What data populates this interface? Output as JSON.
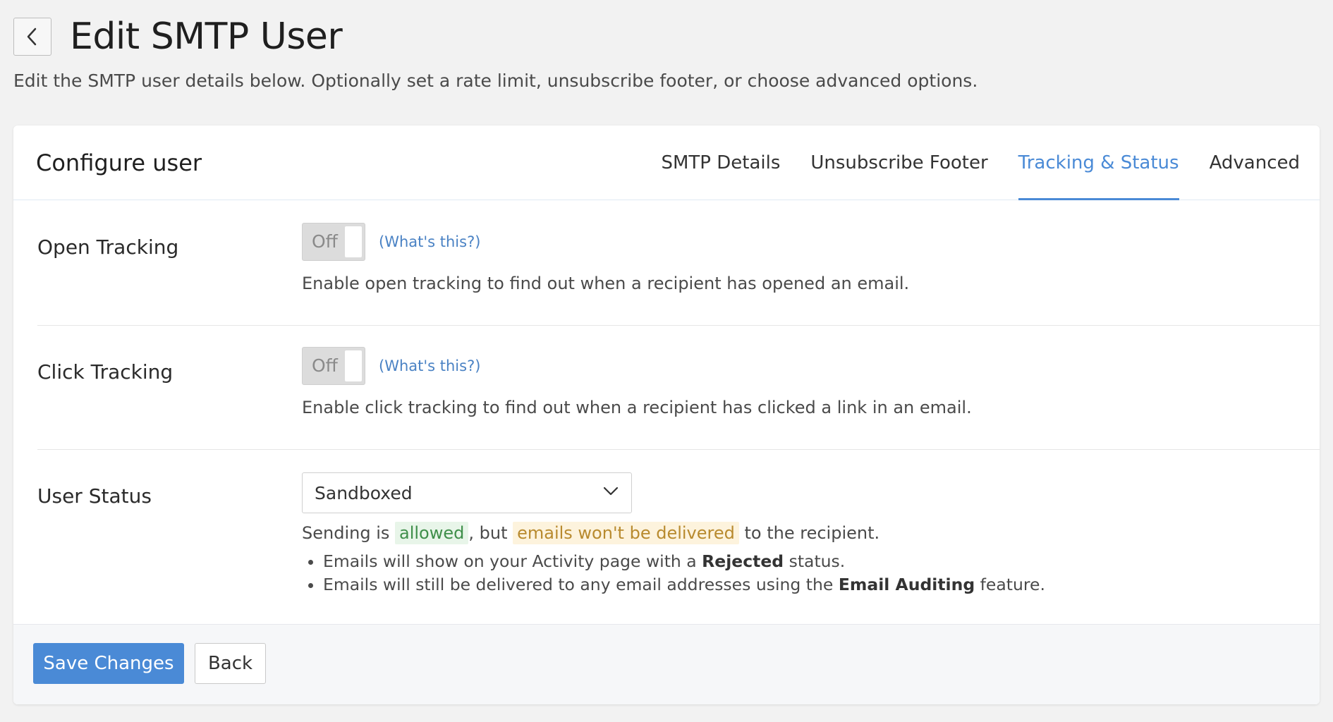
{
  "header": {
    "title": "Edit SMTP User",
    "description": "Edit the SMTP user details below. Optionally set a rate limit, unsubscribe footer, or choose advanced options."
  },
  "card": {
    "title": "Configure user",
    "tabs": [
      {
        "label": "SMTP Details",
        "active": false
      },
      {
        "label": "Unsubscribe Footer",
        "active": false
      },
      {
        "label": "Tracking & Status",
        "active": true
      },
      {
        "label": "Advanced",
        "active": false
      }
    ]
  },
  "open_tracking": {
    "label": "Open Tracking",
    "toggle_state": "Off",
    "help_link": "(What's this?)",
    "description": "Enable open tracking to find out when a recipient has opened an email."
  },
  "click_tracking": {
    "label": "Click Tracking",
    "toggle_state": "Off",
    "help_link": "(What's this?)",
    "description": "Enable click tracking to find out when a recipient has clicked a link in an email."
  },
  "user_status": {
    "label": "User Status",
    "selected": "Sandboxed",
    "line_prefix": "Sending is ",
    "allowed": "allowed",
    "line_mid": ", but ",
    "not_delivered": "emails won't be delivered",
    "line_suffix": " to the recipient.",
    "bullet1_prefix": "Emails will show on your Activity page with a ",
    "bullet1_bold": "Rejected",
    "bullet1_suffix": " status.",
    "bullet2_prefix": "Emails will still be delivered to any email addresses using the ",
    "bullet2_bold": "Email Auditing",
    "bullet2_suffix": " feature."
  },
  "footer": {
    "save_label": "Save Changes",
    "back_label": "Back"
  },
  "colors": {
    "accent": "#4a8ad6",
    "allowed_bg": "#e8f5e9",
    "warning_bg": "#fdf3dd"
  },
  "icons": {
    "back": "chevron-left-icon",
    "select": "chevron-down-icon"
  }
}
